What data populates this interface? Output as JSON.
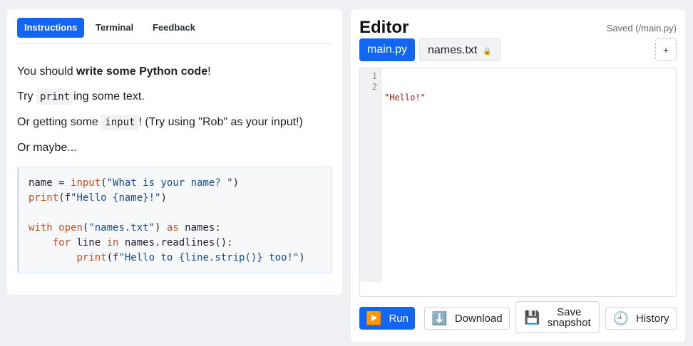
{
  "instructions_panel": {
    "tabs": [
      "Instructions",
      "Terminal",
      "Feedback"
    ],
    "active_tab": "Instructions",
    "line1_prefix": "You should ",
    "line1_bold": "write some Python code",
    "line1_suffix": "!",
    "line2_prefix": "Try ",
    "line2_code": "print",
    "line2_suffix": "ing some text.",
    "line3_prefix": "Or getting some ",
    "line3_code": "input",
    "line3_suffix": "! (Try using \"Rob\" as your input!)",
    "line4": "Or maybe...",
    "example_code": [
      "name = input(\"What is your name? \")",
      "print(f\"Hello {name}!\")",
      "",
      "with open(\"names.txt\") as names:",
      "    for line in names.readlines():",
      "        print(f\"Hello to {line.strip()} too!\")"
    ]
  },
  "editor": {
    "title": "Editor",
    "saved_status": "Saved (/main.py)",
    "files": [
      {
        "name": "main.py",
        "active": true
      },
      {
        "name": "names.txt",
        "active": false,
        "locked": true
      }
    ],
    "add_label": "+",
    "line_numbers": [
      "1",
      "2"
    ],
    "code_lines": [
      "\"Hello!\"",
      ""
    ]
  },
  "buttons": {
    "run": {
      "icon": "play-icon",
      "label": "Run"
    },
    "download": {
      "icon": "download-icon",
      "label": "Download"
    },
    "save_snapshot": {
      "icon": "floppy-icon",
      "label_line1": "Save",
      "label_line2": "snapshot"
    },
    "history": {
      "icon": "clock-icon",
      "label": "History"
    }
  },
  "colors": {
    "accent": "#1266f1",
    "code_keyword": "#c7511f",
    "code_string": "#1a4a8a",
    "editor_string": "#a31515"
  }
}
